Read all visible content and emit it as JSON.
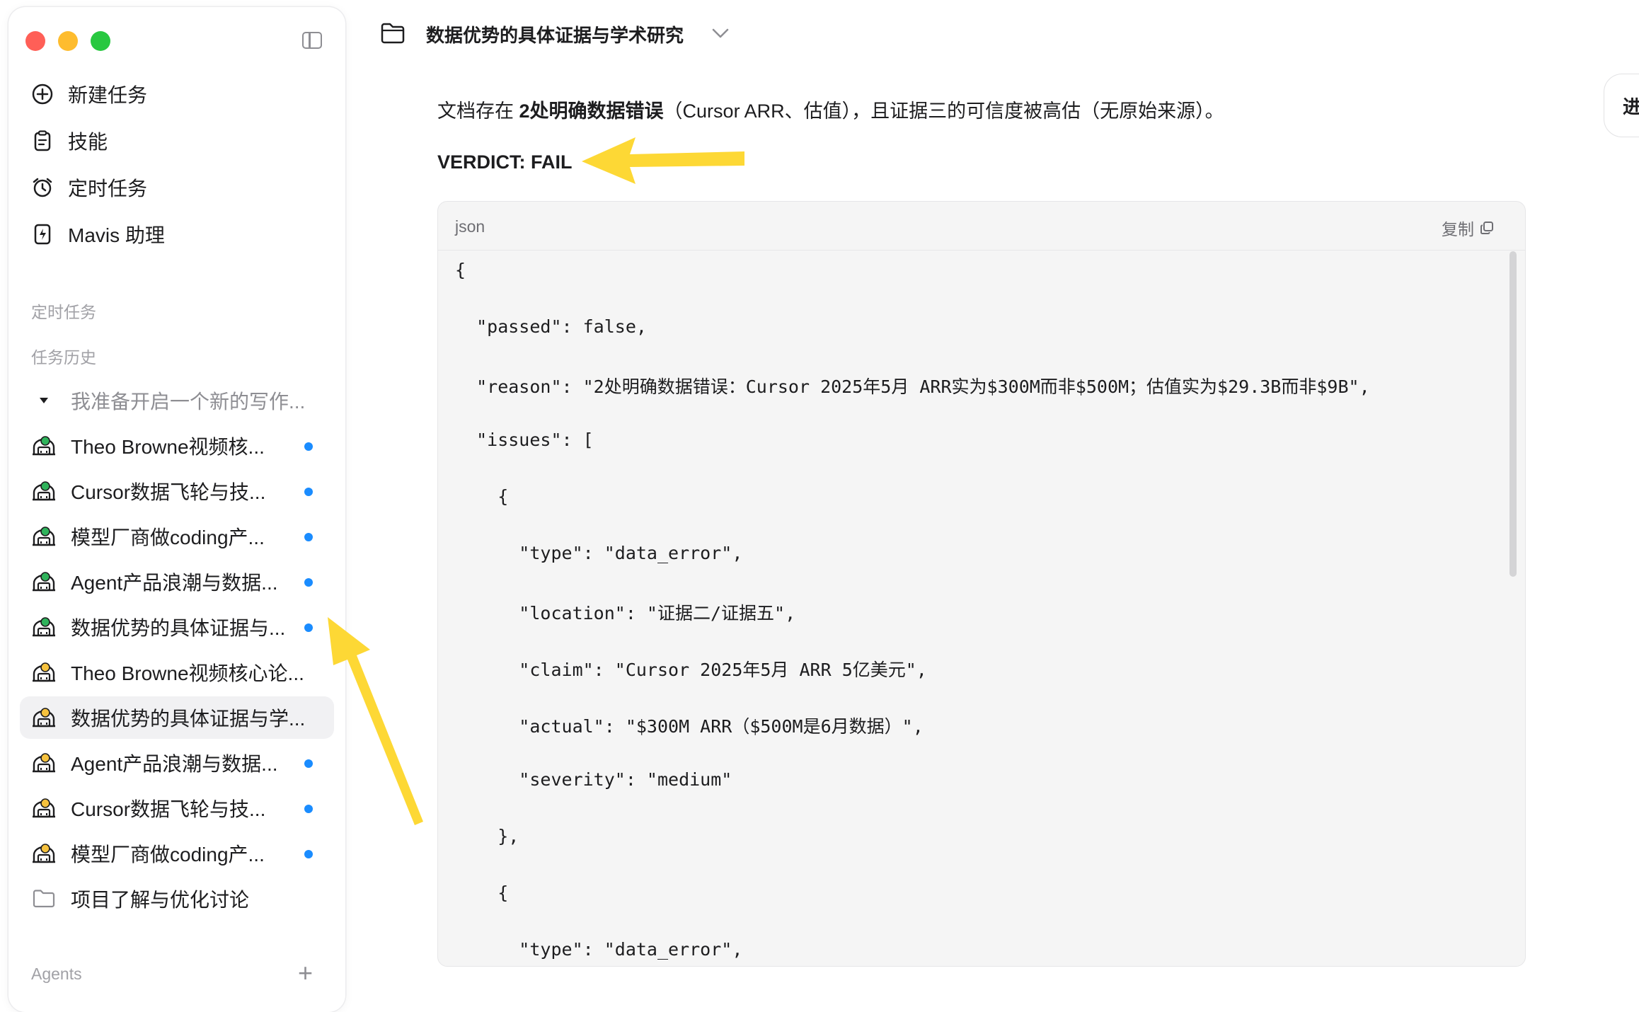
{
  "sidebar": {
    "nav": [
      {
        "label": "新建任务",
        "icon": "plus-circle-icon"
      },
      {
        "label": "技能",
        "icon": "clipboard-icon"
      },
      {
        "label": "定时任务",
        "icon": "alarm-clock-icon"
      },
      {
        "label": "Mavis 助理",
        "icon": "document-bolt-icon"
      }
    ],
    "scheduled_label": "定时任务",
    "history_label": "任务历史",
    "history": [
      {
        "label": "我准备开启一个新的写作...",
        "icon": "caret-down-icon",
        "unread": false,
        "muted": true
      },
      {
        "label": "Theo Browne视频核...",
        "icon": "robot-green-icon",
        "unread": true
      },
      {
        "label": "Cursor数据飞轮与技...",
        "icon": "robot-green-icon",
        "unread": true
      },
      {
        "label": "模型厂商做coding产...",
        "icon": "robot-green-icon",
        "unread": true
      },
      {
        "label": "Agent产品浪潮与数据...",
        "icon": "robot-green-icon",
        "unread": true
      },
      {
        "label": "数据优势的具体证据与...",
        "icon": "robot-green-icon",
        "unread": true
      },
      {
        "label": "Theo Browne视频核心论...",
        "icon": "robot-yellow-icon",
        "unread": false
      },
      {
        "label": "数据优势的具体证据与学...",
        "icon": "robot-yellow-icon",
        "unread": false,
        "active": true
      },
      {
        "label": "Agent产品浪潮与数据...",
        "icon": "robot-yellow-icon",
        "unread": true
      },
      {
        "label": "Cursor数据飞轮与技...",
        "icon": "robot-yellow-icon",
        "unread": true
      },
      {
        "label": "模型厂商做coding产...",
        "icon": "robot-yellow-icon",
        "unread": true
      },
      {
        "label": "项目了解与优化讨论",
        "icon": "folder-icon",
        "unread": false
      }
    ],
    "agents_label": "Agents",
    "agents_add": "+"
  },
  "header": {
    "title": "数据优势的具体证据与学术研究"
  },
  "content": {
    "summary_prefix": "文档存在 ",
    "summary_bold": "2处明确数据错误",
    "summary_suffix": "（Cursor ARR、估值），且证据三的可信度被高估（无原始来源）。",
    "verdict": "VERDICT: FAIL",
    "code": {
      "lang": "json",
      "copy_label": "复制",
      "lines": [
        "{",
        "  \"passed\": false,",
        "  \"reason\": \"2处明确数据错误：Cursor 2025年5月 ARR实为$300M而非$500M；估值实为$29.3B而非$9B\",",
        "  \"issues\": [",
        "    {",
        "      \"type\": \"data_error\",",
        "      \"location\": \"证据二/证据五\",",
        "      \"claim\": \"Cursor 2025年5月 ARR 5亿美元\",",
        "      \"actual\": \"$300M ARR（$500M是6月数据）\",",
        "      \"severity\": \"medium\"",
        "    },",
        "    {",
        "      \"type\": \"data_error\","
      ]
    }
  },
  "right_pill_label": "进",
  "colors": {
    "traffic_red": "#ff5f57",
    "traffic_yellow": "#febc2e",
    "traffic_green": "#28c840",
    "unread_dot": "#1a8cff",
    "arrow": "#fdd835"
  }
}
